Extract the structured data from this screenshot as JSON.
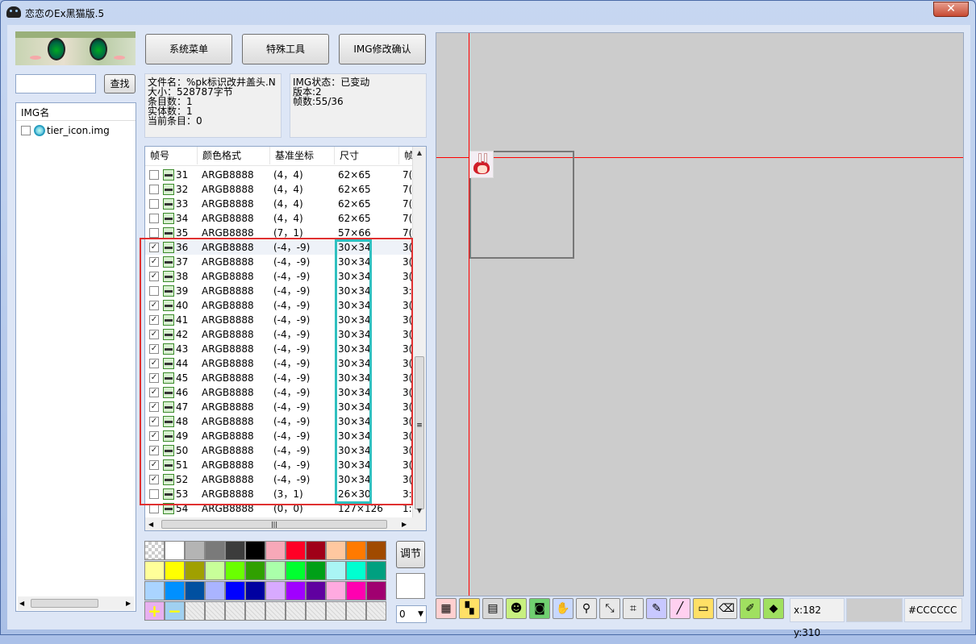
{
  "window": {
    "title": "恋恋のEx黑猫版.5",
    "close": "✕"
  },
  "search": {
    "value": "",
    "button": "查找"
  },
  "img_list": {
    "header": "IMG名",
    "items": [
      {
        "name": "tier_icon.img",
        "checked": false
      }
    ]
  },
  "toolbar": {
    "system_menu": "系统菜单",
    "special_tools": "特殊工具",
    "img_confirm": "IMG修改确认"
  },
  "file_info": {
    "filename": "文件名：%pk标识改井盖头.N",
    "size": "大小：528787字节",
    "entries": "条目数：1",
    "entities": "实体数：1",
    "current": "当前条目：0"
  },
  "img_info": {
    "status": "IMG状态：已变动",
    "version": "版本:2",
    "frames": "帧数:55/36"
  },
  "frame_table": {
    "headers": [
      "帧号",
      "颜色格式",
      "基准坐标",
      "尺寸",
      "帧"
    ],
    "rows": [
      {
        "n": "31",
        "fmt": "ARGB8888",
        "coord": "(4，4)",
        "size": "62×65",
        "extra": "7(",
        "checked": false
      },
      {
        "n": "32",
        "fmt": "ARGB8888",
        "coord": "(4，4)",
        "size": "62×65",
        "extra": "7(",
        "checked": false
      },
      {
        "n": "33",
        "fmt": "ARGB8888",
        "coord": "(4，4)",
        "size": "62×65",
        "extra": "7(",
        "checked": false
      },
      {
        "n": "34",
        "fmt": "ARGB8888",
        "coord": "(4，4)",
        "size": "62×65",
        "extra": "7(",
        "checked": false
      },
      {
        "n": "35",
        "fmt": "ARGB8888",
        "coord": "(7，1)",
        "size": "57×66",
        "extra": "7(",
        "checked": false
      },
      {
        "n": "36",
        "fmt": "ARGB8888",
        "coord": "(-4，-9)",
        "size": "30×34",
        "extra": "3(",
        "checked": true
      },
      {
        "n": "37",
        "fmt": "ARGB8888",
        "coord": "(-4，-9)",
        "size": "30×34",
        "extra": "3(",
        "checked": true
      },
      {
        "n": "38",
        "fmt": "ARGB8888",
        "coord": "(-4，-9)",
        "size": "30×34",
        "extra": "3(",
        "checked": true
      },
      {
        "n": "39",
        "fmt": "ARGB8888",
        "coord": "(-4，-9)",
        "size": "30×34",
        "extra": "3:",
        "checked": false
      },
      {
        "n": "40",
        "fmt": "ARGB8888",
        "coord": "(-4，-9)",
        "size": "30×34",
        "extra": "3(",
        "checked": true
      },
      {
        "n": "41",
        "fmt": "ARGB8888",
        "coord": "(-4，-9)",
        "size": "30×34",
        "extra": "3(",
        "checked": true
      },
      {
        "n": "42",
        "fmt": "ARGB8888",
        "coord": "(-4，-9)",
        "size": "30×34",
        "extra": "3(",
        "checked": true
      },
      {
        "n": "43",
        "fmt": "ARGB8888",
        "coord": "(-4，-9)",
        "size": "30×34",
        "extra": "3(",
        "checked": true
      },
      {
        "n": "44",
        "fmt": "ARGB8888",
        "coord": "(-4，-9)",
        "size": "30×34",
        "extra": "3(",
        "checked": true
      },
      {
        "n": "45",
        "fmt": "ARGB8888",
        "coord": "(-4，-9)",
        "size": "30×34",
        "extra": "3(",
        "checked": true
      },
      {
        "n": "46",
        "fmt": "ARGB8888",
        "coord": "(-4，-9)",
        "size": "30×34",
        "extra": "3(",
        "checked": true
      },
      {
        "n": "47",
        "fmt": "ARGB8888",
        "coord": "(-4，-9)",
        "size": "30×34",
        "extra": "3(",
        "checked": true
      },
      {
        "n": "48",
        "fmt": "ARGB8888",
        "coord": "(-4，-9)",
        "size": "30×34",
        "extra": "3(",
        "checked": true
      },
      {
        "n": "49",
        "fmt": "ARGB8888",
        "coord": "(-4，-9)",
        "size": "30×34",
        "extra": "3(",
        "checked": true
      },
      {
        "n": "50",
        "fmt": "ARGB8888",
        "coord": "(-4，-9)",
        "size": "30×34",
        "extra": "3(",
        "checked": true
      },
      {
        "n": "51",
        "fmt": "ARGB8888",
        "coord": "(-4，-9)",
        "size": "30×34",
        "extra": "3(",
        "checked": true
      },
      {
        "n": "52",
        "fmt": "ARGB8888",
        "coord": "(-4，-9)",
        "size": "30×34",
        "extra": "3(",
        "checked": true
      },
      {
        "n": "53",
        "fmt": "ARGB8888",
        "coord": "(3，1)",
        "size": "26×30",
        "extra": "3:",
        "checked": false
      },
      {
        "n": "54",
        "fmt": "ARGB8888",
        "coord": "(0，0)",
        "size": "127×126",
        "extra": "1:",
        "checked": false
      }
    ]
  },
  "palette": {
    "adjust_button": "调节",
    "number_select": "0",
    "rows": [
      [
        "checker",
        "#ffffff",
        "#b4b4b4",
        "#7a7a7a",
        "#3c3c3c",
        "#000000",
        "#f7a8b8",
        "#ff0026",
        "#a00018",
        "#ffc8a0",
        "#ff7a00",
        "#a04a00"
      ],
      [
        "#ffff99",
        "#ffff00",
        "#a0a000",
        "#c8ff99",
        "#6aff00",
        "#30a000",
        "#aaffaa",
        "#00ff30",
        "#00a018",
        "#aaf5f5",
        "#00ffd0",
        "#00a080"
      ],
      [
        "#aad4ff",
        "#0090ff",
        "#0050a0",
        "#aab4ff",
        "#0000ff",
        "#0000a0",
        "#d8aaff",
        "#a000ff",
        "#6000a0",
        "#ffaae0",
        "#ff00b0",
        "#a00070"
      ],
      [
        "plus",
        "minus",
        "empty",
        "empty",
        "empty",
        "empty",
        "empty",
        "empty",
        "empty",
        "empty",
        "empty",
        "empty"
      ]
    ]
  },
  "tools": [
    {
      "name": "grid-tool-icon",
      "glyph": "▦",
      "bg": "#ffd0d0"
    },
    {
      "name": "palette-tool-icon",
      "glyph": "▚",
      "bg": "#ffe066"
    },
    {
      "name": "film-tool-icon",
      "glyph": "▤",
      "bg": "#d8d8d8"
    },
    {
      "name": "cat-tool-icon",
      "glyph": "☻",
      "bg": "#c8f080"
    },
    {
      "name": "camera-tool-icon",
      "glyph": "◙",
      "bg": "#70d070"
    },
    {
      "name": "hand-tool-icon",
      "glyph": "✋",
      "bg": "#c8d8ff"
    },
    {
      "name": "zoom-tool-icon",
      "glyph": "⚲",
      "bg": "#e8e8e8"
    },
    {
      "name": "move-tool-icon",
      "glyph": "⤡",
      "bg": "#e8e8e8"
    },
    {
      "name": "crop-tool-icon",
      "glyph": "⌗",
      "bg": "#e8e8e8"
    },
    {
      "name": "pencil-tool-icon",
      "glyph": "✎",
      "bg": "#c8c8ff"
    },
    {
      "name": "line-tool-icon",
      "glyph": "╱",
      "bg": "#ffd0f0"
    },
    {
      "name": "rect-tool-icon",
      "glyph": "▭",
      "bg": "#ffe066"
    },
    {
      "name": "eraser-tool-icon",
      "glyph": "⌫",
      "bg": "#e8e8e8"
    },
    {
      "name": "eyedropper-tool-icon",
      "glyph": "✐",
      "bg": "#a0e060"
    },
    {
      "name": "fill-tool-icon",
      "glyph": "◆",
      "bg": "#a0e060"
    }
  ],
  "status": {
    "coords": "x:182 y:310",
    "color_hex": "#CCCCCC"
  },
  "colors": {
    "selection_red": "#e03030",
    "selection_teal": "#30c0c0",
    "crosshair": "#ff0000"
  }
}
